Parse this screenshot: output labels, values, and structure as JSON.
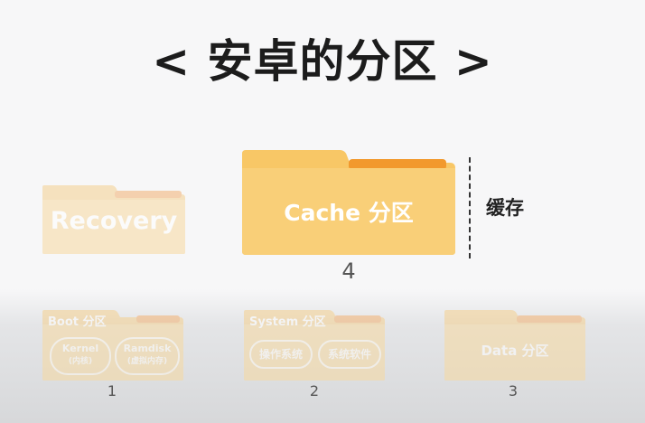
{
  "title": "< 安卓的分区 >",
  "recovery": {
    "label": "Recovery"
  },
  "cache": {
    "label": "Cache 分区",
    "number": "4",
    "side_label": "缓存"
  },
  "boot": {
    "label": "Boot 分区",
    "number": "1",
    "chips": [
      {
        "line1": "Kernel",
        "line2": "(内核)"
      },
      {
        "line1": "Ramdisk",
        "line2": "(虚拟内存)"
      }
    ]
  },
  "system": {
    "label": "System 分区",
    "number": "2",
    "chips": [
      {
        "line1": "操作系统"
      },
      {
        "line1": "系统软件"
      }
    ]
  },
  "data": {
    "label": "Data 分区",
    "number": "3"
  },
  "colors": {
    "folder_body": "#f9d37b",
    "folder_tab": "#f3a445",
    "folder_tab_light": "#f6c27a"
  }
}
